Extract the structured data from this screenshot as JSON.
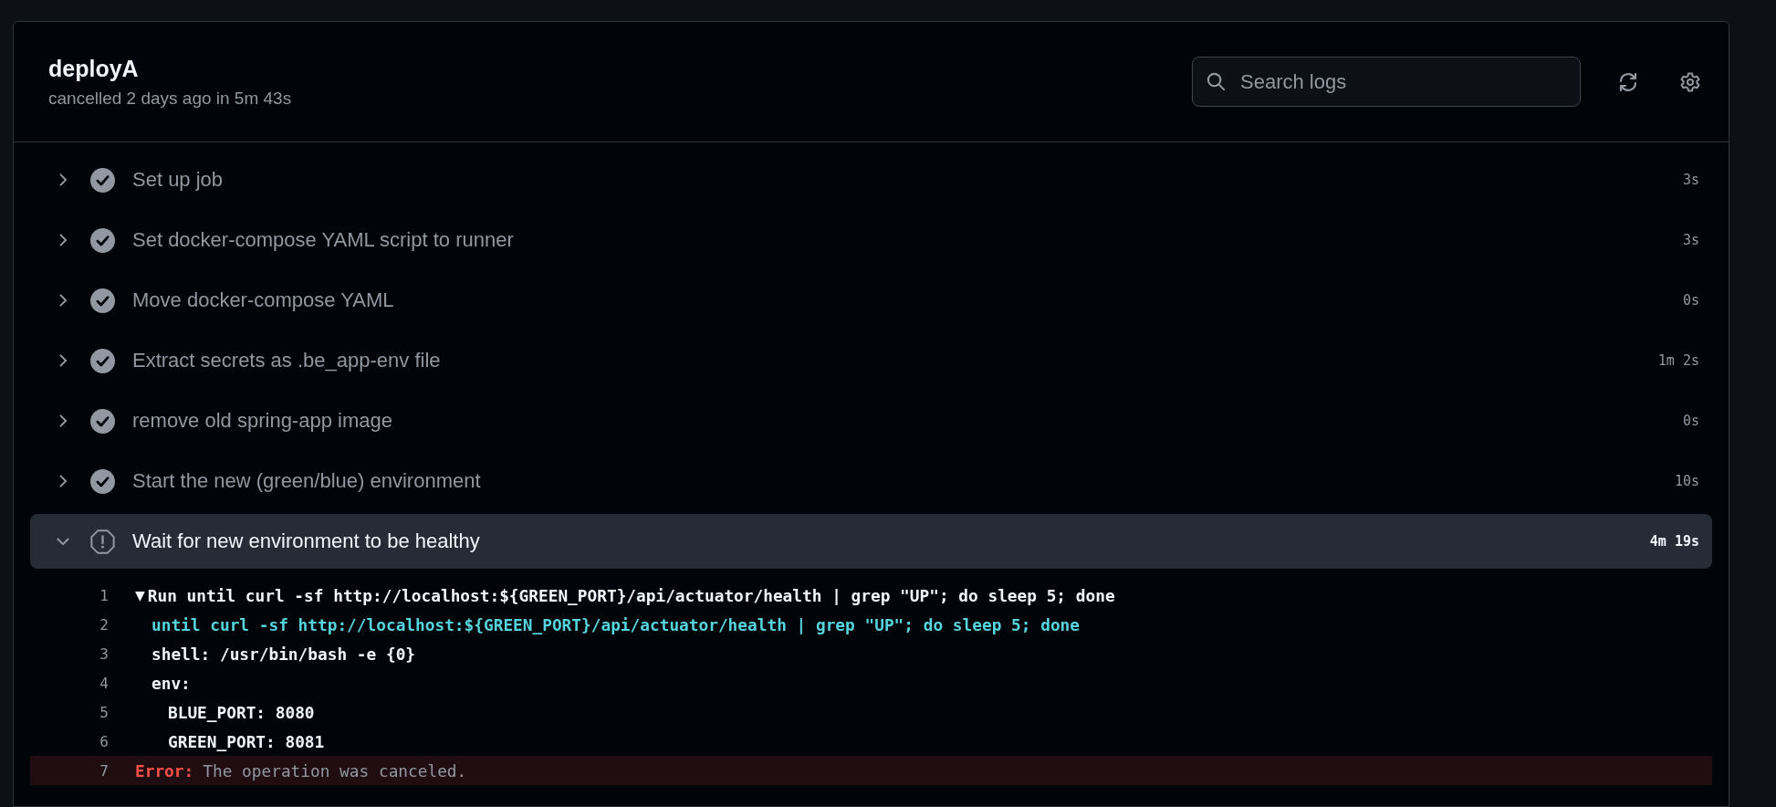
{
  "job": {
    "title": "deployA",
    "summary": "cancelled 2 days ago in 5m 43s"
  },
  "search": {
    "placeholder": "Search logs"
  },
  "steps": [
    {
      "name": "Set up job",
      "kind": "success",
      "expanded": false,
      "duration": "3s"
    },
    {
      "name": "Set docker-compose YAML script to runner",
      "kind": "success",
      "expanded": false,
      "duration": "3s"
    },
    {
      "name": "Move docker-compose YAML",
      "kind": "success",
      "expanded": false,
      "duration": "0s"
    },
    {
      "name": "Extract secrets as .be_app-env file",
      "kind": "success",
      "expanded": false,
      "duration": "1m 2s"
    },
    {
      "name": "remove old spring-app image",
      "kind": "success",
      "expanded": false,
      "duration": "0s"
    },
    {
      "name": "Start the new (green/blue) environment",
      "kind": "success",
      "expanded": false,
      "duration": "10s"
    },
    {
      "name": "Wait for new environment to be healthy",
      "kind": "cancelled",
      "expanded": true,
      "duration": "4m 19s",
      "log": [
        {
          "number": "1",
          "kind": "group",
          "toggle": "▼",
          "text": "Run until curl -sf http://localhost:${GREEN_PORT}/api/actuator/health | grep \"UP\"; do sleep 5; done",
          "children": [
            {
              "number": "2",
              "kind": "command",
              "text": "until curl -sf http://localhost:${GREEN_PORT}/api/actuator/health | grep \"UP\"; do sleep 5; done"
            },
            {
              "number": "3",
              "kind": "plain",
              "text": "shell: /usr/bin/bash -e {0}"
            },
            {
              "number": "4",
              "kind": "plain",
              "text": "env:",
              "children": [
                {
                  "number": "5",
                  "kind": "plain",
                  "text": "BLUE_PORT: 8080"
                },
                {
                  "number": "6",
                  "kind": "plain",
                  "text": "GREEN_PORT: 8081"
                }
              ]
            }
          ]
        },
        {
          "number": "7",
          "kind": "error",
          "label": "Error:",
          "text": "The operation was canceled."
        }
      ]
    }
  ]
}
